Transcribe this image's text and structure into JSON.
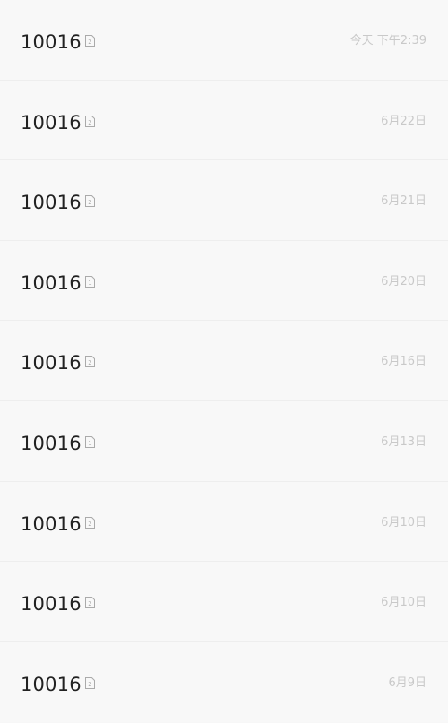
{
  "messages": [
    {
      "sender": "10016",
      "sim": "2",
      "time": "今天 下午2:39"
    },
    {
      "sender": "10016",
      "sim": "2",
      "time": "6月22日"
    },
    {
      "sender": "10016",
      "sim": "2",
      "time": "6月21日"
    },
    {
      "sender": "10016",
      "sim": "1",
      "time": "6月20日"
    },
    {
      "sender": "10016",
      "sim": "2",
      "time": "6月16日"
    },
    {
      "sender": "10016",
      "sim": "1",
      "time": "6月13日"
    },
    {
      "sender": "10016",
      "sim": "2",
      "time": "6月10日"
    },
    {
      "sender": "10016",
      "sim": "2",
      "time": "6月10日"
    },
    {
      "sender": "10016",
      "sim": "2",
      "time": "6月9日"
    }
  ],
  "icons": {
    "sim": "sim-card-icon"
  },
  "colors": {
    "background": "#f8f8f8",
    "sender_text": "#222222",
    "time_text": "#c9c9c9",
    "divider": "#eeeeee"
  }
}
